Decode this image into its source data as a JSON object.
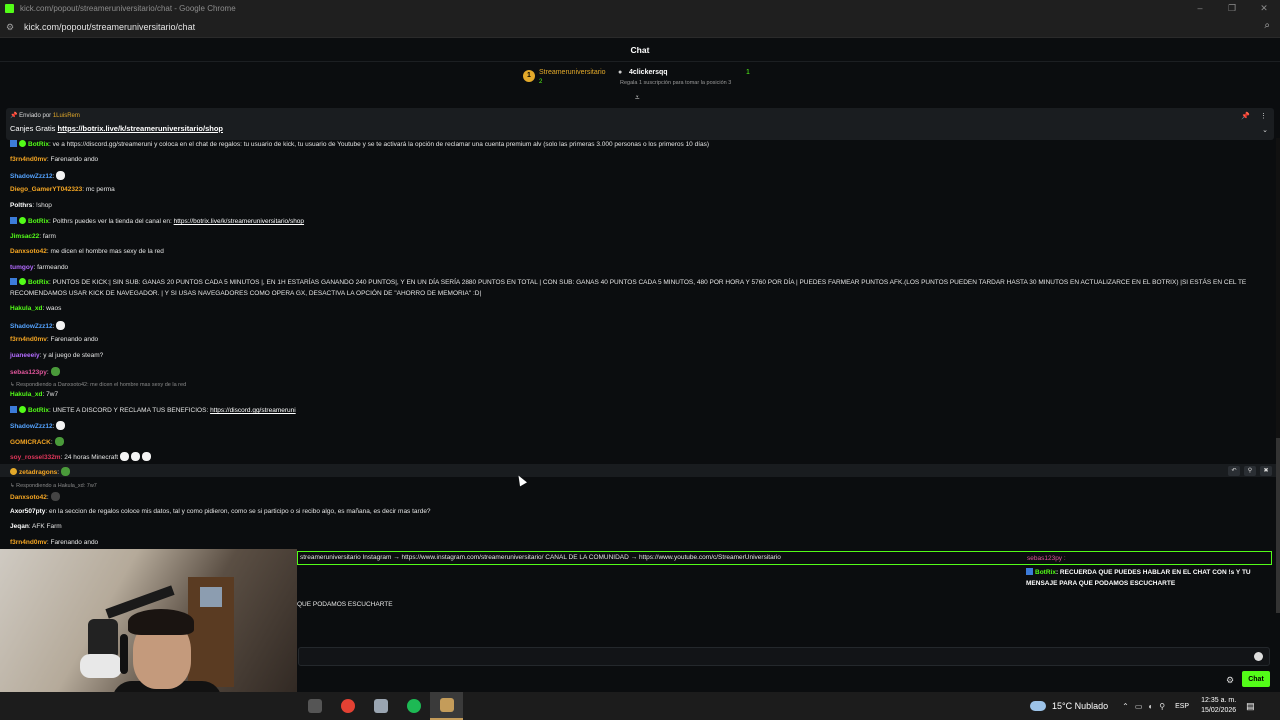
{
  "browser": {
    "window_title": "kick.com/popout/streameruniversitario/chat - Google Chrome",
    "url": "kick.com/popout/streameruniversitario/chat"
  },
  "chat": {
    "title": "Chat",
    "leaderboard": {
      "rank": "1",
      "first_user": "Streameruniversitario",
      "first_count": "2",
      "second_user": "4clickersqq",
      "second_count": "1",
      "hint": "Regala 1 suscripción para tomar la posición 3"
    },
    "pinned": {
      "sent_by": "Enviado por",
      "sender": "1LuisRem",
      "prefix": "Canjes Gratis",
      "link": "https://botrix.live/k/streameruniversitario/shop"
    },
    "messages": [
      {
        "user": "BotRix",
        "color": "#53fc18",
        "text": ": ve a https://discord.gg/streameruni y coloca en el chat de regalos: tu usuario de kick, tu usuario de Youtube y se te activará la opción de reclamar una cuenta premium alv (solo las primeras 3.000 personas o los primeros 10 días)"
      },
      {
        "user": "f3rn4nd0mv",
        "color": "#f5a623",
        "text": ": Farenando ando"
      },
      {
        "user": "ShadowZzz12",
        "color": "#54a3ff",
        "text": ":"
      },
      {
        "user": "Diego_GamerYT042323",
        "color": "#f5a623",
        "text": ": mc perma"
      },
      {
        "user": "Polthrs",
        "color": "#ffffff",
        "text": ": !shop"
      },
      {
        "user": "BotRix",
        "color": "#53fc18",
        "text": ": Polthrs puedes ver la tienda del canal en: ",
        "link": "https://botrix.live/k/streameruniversitario/shop"
      },
      {
        "user": "Jimsac22",
        "color": "#53fc18",
        "text": ": farm"
      },
      {
        "user": "Danxsoto42",
        "color": "#f5a623",
        "text": ": me dicen el hombre mas sexy de la red"
      },
      {
        "user": "tumgoy",
        "color": "#b36bff",
        "text": ": farmeando"
      },
      {
        "user": "BotRix",
        "color": "#53fc18",
        "text": ": PUNTOS DE KICK:| SIN SUB: GANAS 20 PUNTOS CADA 5 MINUTOS |, EN 1H ESTARÍAS GANANDO 240 PUNTOS|, Y EN UN DÍA SERÍA 2880 PUNTOS EN TOTAL | CON SUB: GANAS 40 PUNTOS CADA 5 MINUTOS, 480 POR HORA Y 5760 POR DÍA | PUEDES FARMEAR PUNTOS AFK.(LOS PUNTOS PUEDEN TARDAR HASTA 30 MINUTOS EN ACTUALIZARCE EN EL BOTRIX) |SI ESTÁS EN CEL TE RECOMENDAMOS USAR KICK DE NAVEGADOR. | Y SI USAS NAVEGADORES COMO OPERA GX, DESACTIVA LA OPCIÓN DE \"AHORRO DE MEMORIA\" :D|"
      },
      {
        "user": "Hakula_xd",
        "color": "#53fc18",
        "text": ": waos"
      },
      {
        "user": "ShadowZzz12",
        "color": "#54a3ff",
        "text": ":"
      },
      {
        "user": "f3rn4nd0mv",
        "color": "#f5a623",
        "text": ": Farenando ando"
      },
      {
        "user": "juaneeeiy",
        "color": "#b36bff",
        "text": ": y al juego de steam?"
      },
      {
        "user": "sebas123py",
        "color": "#e0569b",
        "text": ":"
      },
      {
        "user": "Hakula_xd",
        "color": "#53fc18",
        "text": ": 7w7",
        "reply": "Respondiendo a Danxsoto42: me dicen el hombre mas sexy de la red"
      },
      {
        "user": "BotRix",
        "color": "#53fc18",
        "text": ": UNETE A DISCORD Y RECLAMA TUS BENEFICIOS: ",
        "link": "https://discord.gg/streameruni"
      },
      {
        "user": "ShadowZzz12",
        "color": "#54a3ff",
        "text": ":"
      },
      {
        "user": "GOMICRACK",
        "color": "#f5a623",
        "text": ":"
      },
      {
        "user": "soy_rossel332m",
        "color": "#e0365a",
        "text": ": 24 horas Minecraft"
      },
      {
        "user": "zetadragons",
        "color": "#f5a623",
        "text": ":"
      },
      {
        "user": "Danxsoto42",
        "color": "#f5a623",
        "text": ":",
        "reply": "Respondiendo a Hakula_xd: 7w7"
      },
      {
        "user": "Axor507pty",
        "color": "#ffffff",
        "text": ": en la seccion de regalos coloce mis datos, tal y como pidieron, como se si participo o si recibo algo, es mañana, es decir mas tarde?"
      },
      {
        "user": "Jeqan",
        "color": "#ffffff",
        "text": ": AFK Farm"
      },
      {
        "user": "f3rn4nd0mv",
        "color": "#f5a623",
        "text": ": Farenando ando"
      }
    ],
    "overlay": {
      "line": "streameruniversitario Instagram → https://www.instagram.com/streameruniversitario/ CANAL DE LA COMUNIDAD → https://www.youtube.com/c/StreamerUniversitario",
      "side_user": "sebas123py :",
      "bot_user": "BotRix",
      "bot_text": ": RECUERDA QUE PUEDES HABLAR EN EL CHAT CON !s Y TU MENSAJE PARA QUE PODAMOS ESCUCHARTE",
      "trail": "QUE PODAMOS ESCUCHARTE"
    },
    "input_placeholder": "",
    "send_label": "Chat"
  },
  "taskbar": {
    "weather": "15°C Nublado",
    "lang": "ESP",
    "time": "12:35 a. m.",
    "date": "15/02/2026"
  },
  "colors": {
    "accent": "#53fc18",
    "bg": "#0b0d0f"
  }
}
